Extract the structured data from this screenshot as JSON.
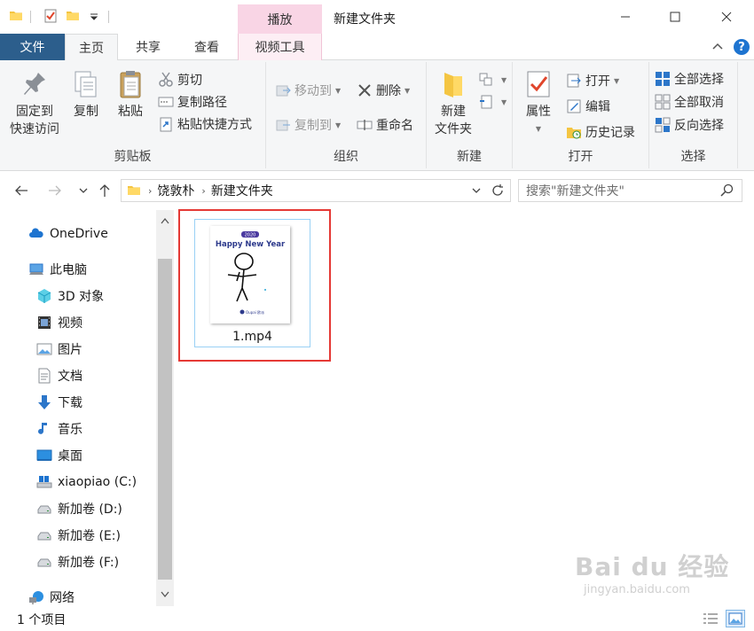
{
  "titlebar": {
    "context_tab": "播放",
    "window_title": "新建文件夹",
    "minimize": "—",
    "maximize": "☐",
    "close": "✕"
  },
  "tabs": [
    {
      "label": "文件"
    },
    {
      "label": "主页"
    },
    {
      "label": "共享"
    },
    {
      "label": "查看"
    },
    {
      "label": "视频工具"
    }
  ],
  "ribbon": {
    "clipboard": {
      "label": "剪贴板",
      "pin_line1": "固定到",
      "pin_line2": "快速访问",
      "copy": "复制",
      "paste": "粘贴",
      "cut": "剪切",
      "copy_path": "复制路径",
      "paste_shortcut": "粘贴快捷方式"
    },
    "organize": {
      "label": "组织",
      "move_to": "移动到",
      "copy_to": "复制到",
      "delete": "删除",
      "rename": "重命名"
    },
    "new": {
      "label": "新建",
      "new_folder_line1": "新建",
      "new_folder_line2": "文件夹"
    },
    "open": {
      "label": "打开",
      "properties": "属性",
      "open": "打开",
      "edit": "编辑",
      "history": "历史记录"
    },
    "select": {
      "label": "选择",
      "select_all": "全部选择",
      "select_none": "全部取消",
      "invert": "反向选择"
    }
  },
  "address": {
    "crumbs": [
      "饶敦朴",
      "新建文件夹"
    ],
    "search_placeholder": "搜索\"新建文件夹\""
  },
  "nav_pane": {
    "items": [
      {
        "label": "OneDrive"
      },
      {
        "label": "此电脑"
      },
      {
        "label": "3D 对象"
      },
      {
        "label": "视频"
      },
      {
        "label": "图片"
      },
      {
        "label": "文档"
      },
      {
        "label": "下载"
      },
      {
        "label": "音乐"
      },
      {
        "label": "桌面"
      },
      {
        "label": "xiaopiao (C:)"
      },
      {
        "label": "新加卷 (D:)"
      },
      {
        "label": "新加卷 (E:)"
      },
      {
        "label": "新加卷 (F:)"
      },
      {
        "label": "网络"
      }
    ]
  },
  "content": {
    "files": [
      {
        "name": "1.mp4",
        "thumb_badge": "2020",
        "thumb_title": "Happy New Year",
        "thumb_brand": "Oupai 欧派"
      }
    ]
  },
  "status": {
    "item_count": "1 个项目"
  },
  "watermark": {
    "logo": "Bai du 经验",
    "url": "jingyan.baidu.com"
  },
  "colors": {
    "accent": "#1e74d0",
    "context_tab": "#f9d5e5",
    "selection_border": "#e53935",
    "file_tab": "#2c5e8c"
  }
}
